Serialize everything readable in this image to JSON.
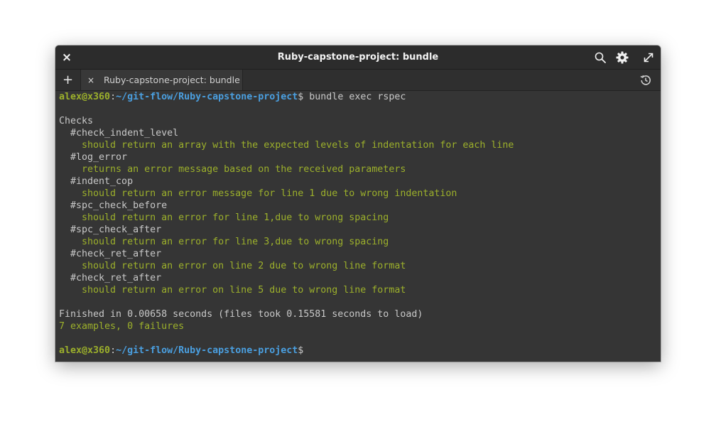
{
  "window": {
    "title": "Ruby-capstone-project: bundle",
    "close_glyph": "×",
    "tab_add_glyph": "+",
    "tabs": [
      {
        "label": "Ruby-capstone-project: bundle",
        "close_glyph": "×"
      }
    ]
  },
  "terminal": {
    "prompt": {
      "user_host": "alex@x360",
      "separator": ":",
      "path": "~/git-flow/Ruby-capstone-project",
      "symbol": "$"
    },
    "command": " bundle exec rspec",
    "output": [
      {
        "text": "",
        "style": "plain"
      },
      {
        "text": "Checks",
        "style": "plain"
      },
      {
        "text": "  #check_indent_level",
        "style": "plain"
      },
      {
        "text": "    should return an array with the expected levels of indentation for each line",
        "style": "pass"
      },
      {
        "text": "  #log_error",
        "style": "plain"
      },
      {
        "text": "    returns an error message based on the received parameters",
        "style": "pass"
      },
      {
        "text": "  #indent_cop",
        "style": "plain"
      },
      {
        "text": "    should return an error message for line 1 due to wrong indentation",
        "style": "pass"
      },
      {
        "text": "  #spc_check_before",
        "style": "plain"
      },
      {
        "text": "    should return an error for line 1,due to wrong spacing",
        "style": "pass"
      },
      {
        "text": "  #spc_check_after",
        "style": "plain"
      },
      {
        "text": "    should return an error for line 3,due to wrong spacing",
        "style": "pass"
      },
      {
        "text": "  #check_ret_after",
        "style": "plain"
      },
      {
        "text": "    should return an error on line 2 due to wrong line format",
        "style": "pass"
      },
      {
        "text": "  #check_ret_after",
        "style": "plain"
      },
      {
        "text": "    should return an error on line 5 due to wrong line format",
        "style": "pass"
      },
      {
        "text": "",
        "style": "plain"
      },
      {
        "text": "Finished in 0.00658 seconds (files took 0.15581 seconds to load)",
        "style": "plain"
      },
      {
        "text": "7 examples, 0 failures",
        "style": "pass"
      },
      {
        "text": "",
        "style": "plain"
      }
    ]
  },
  "colors": {
    "background": "#353535",
    "titlebar": "#2c2c2c",
    "prompt_user": "#9cb02b",
    "prompt_path": "#4a9fe0",
    "pass_text": "#9cb02b",
    "default_text": "#c8c8c8"
  },
  "icons": {
    "close": "close-icon",
    "search": "search-icon",
    "settings": "gear-icon",
    "fullscreen": "expand-icon",
    "add_tab": "plus-icon",
    "history": "history-icon"
  }
}
